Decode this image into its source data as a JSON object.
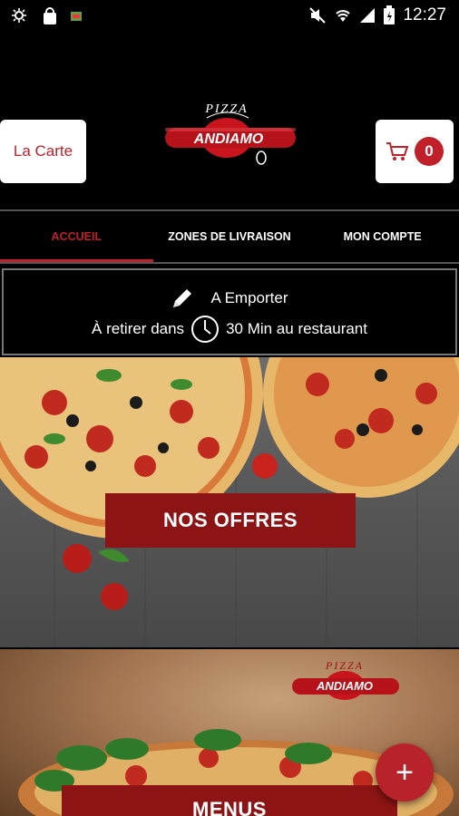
{
  "status_bar": {
    "time": "12:27"
  },
  "header": {
    "carte_label": "La Carte",
    "cart_count": "0",
    "logo_top": "PIZZA",
    "logo_name": "ANDIAMO"
  },
  "tabs": [
    {
      "label": "ACCUEIL",
      "active": true
    },
    {
      "label": "ZONES DE LIVRAISON",
      "active": false
    },
    {
      "label": "MON COMPTE",
      "active": false
    }
  ],
  "pickup": {
    "mode": "A Emporter",
    "prefix": "À retirer dans",
    "suffix": "30 Min au restaurant"
  },
  "banners": {
    "offers_label": "NOS OFFRES",
    "menus_label": "MENUS",
    "logo_top": "PIZZA",
    "logo_name": "ANDIAMO"
  },
  "fab": {
    "label": "+"
  },
  "colors": {
    "accent": "#c0202a",
    "cta": "#8c1414",
    "fab": "#b8232b"
  }
}
